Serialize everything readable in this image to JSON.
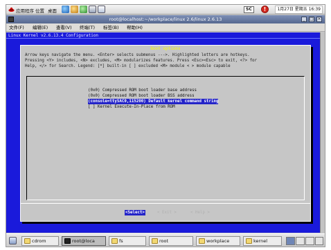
{
  "top_panel": {
    "menus": [
      "应用程序",
      "位置",
      "桌面"
    ],
    "sc_badge": "SC",
    "clock": "1月27日 星期五 16:39"
  },
  "window": {
    "title": "root@localhost:~/workplace/linux 2.6/linux 2.6.13"
  },
  "menubar": [
    "文件(F)",
    "编辑(E)",
    "查看(V)",
    "终端(T)",
    "标签(B)",
    "帮助(H)"
  ],
  "terminal": {
    "header": "Linux Kernel v2.6.13.4 Configuration",
    "dialog_title": "Boot options",
    "help_lines": [
      "Arrow keys navigate the menu.  <Enter> selects submenus --->.  Highlighted letters are hotkeys.",
      "Pressing <Y> includes, <N> excludes, <M> modularizes features.  Press <Esc><Esc> to exit, <?> for",
      "Help, </> for Search.  Legend: [*] built-in  [ ] excluded  <M> module  < > module capable"
    ],
    "menu_items": [
      "(0x0) Compressed ROM boot loader base address",
      "(0x0) Compressed ROM boot loader BSS address",
      "(console=ttySAC0,115200) Default kernel command string",
      "[ ] Kernel Execute-In-Place from ROM"
    ],
    "selected_index": 2,
    "buttons": {
      "select": "<Select>",
      "exit": "< Exit >",
      "help": "< Help >"
    }
  },
  "taskbar": {
    "items": [
      "cdrom",
      "root@loca",
      "fs",
      "root",
      "workplace",
      "kernel"
    ],
    "active_index": 1
  },
  "colors": {
    "terminal_bg": "#1a1adb",
    "dialog_bg": "#c6c6c6",
    "selection": "#2424c8",
    "hotkey": "#c01818"
  }
}
